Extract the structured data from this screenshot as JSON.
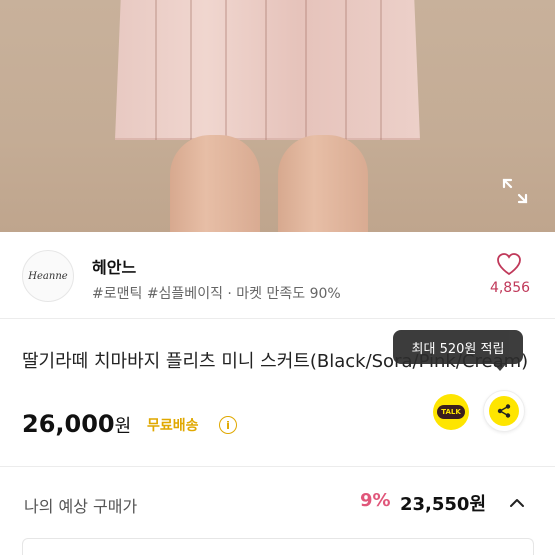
{
  "seller": {
    "logo_text": "Heanne",
    "name": "헤안느",
    "tags": "#로맨틱 #심플베이직 · 마켓 만족도 90%",
    "like_count": "4,856"
  },
  "product": {
    "title": "딸기라떼 치마바지 플리츠 미니 스커트(Black/Sora/Pink/Cream)",
    "price": "26,000",
    "price_unit": "원",
    "shipping": "무료배송",
    "info_glyph": "i",
    "points_tooltip": "최대 520원 적립",
    "talk_label": "TALK"
  },
  "expected_price": {
    "label": "나의 예상 구매가",
    "discount_rate": "9%",
    "amount": "23,550원"
  },
  "colors": {
    "accent_pink": "#e0567a",
    "heart_pink": "#c0395a",
    "shipping_yellow": "#e0a800",
    "kakao_yellow": "#fee500"
  },
  "icons": {
    "expand": "expand-icon",
    "heart": "heart-icon",
    "info": "info-icon",
    "talk": "kakao-talk-icon",
    "share": "share-icon",
    "chevron": "chevron-up-icon"
  }
}
